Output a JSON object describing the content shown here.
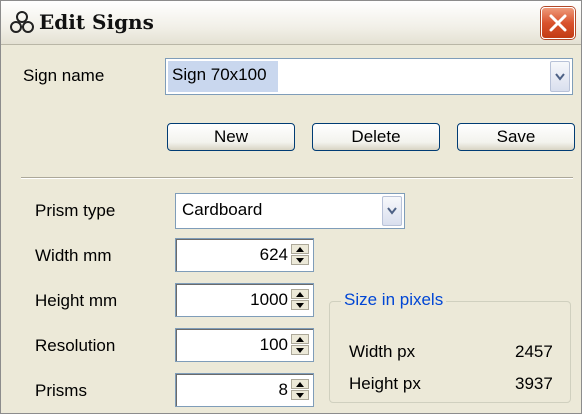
{
  "window": {
    "title": "Edit Signs",
    "title_icon": "signs-icon",
    "close_icon": "close-icon"
  },
  "sign": {
    "label": "Sign name",
    "value": "Sign 70x100"
  },
  "buttons": {
    "new": "New",
    "delete": "Delete",
    "save": "Save"
  },
  "prism_type": {
    "label": "Prism type",
    "value": "Cardboard"
  },
  "fields": {
    "width_label": "Width mm",
    "width_value": "624",
    "height_label": "Height mm",
    "height_value": "1000",
    "resolution_label": "Resolution",
    "resolution_value": "100",
    "prisms_label": "Prisms",
    "prisms_value": "8"
  },
  "size_pixels": {
    "title": "Size in pixels",
    "width_label": "Width px",
    "width_value": "2457",
    "height_label": "Height px",
    "height_value": "3937"
  },
  "colors": {
    "window_bg": "#ece9d8",
    "selection": "#c9d7ee",
    "group_title": "#0046d5",
    "close_red": "#d9522d"
  }
}
